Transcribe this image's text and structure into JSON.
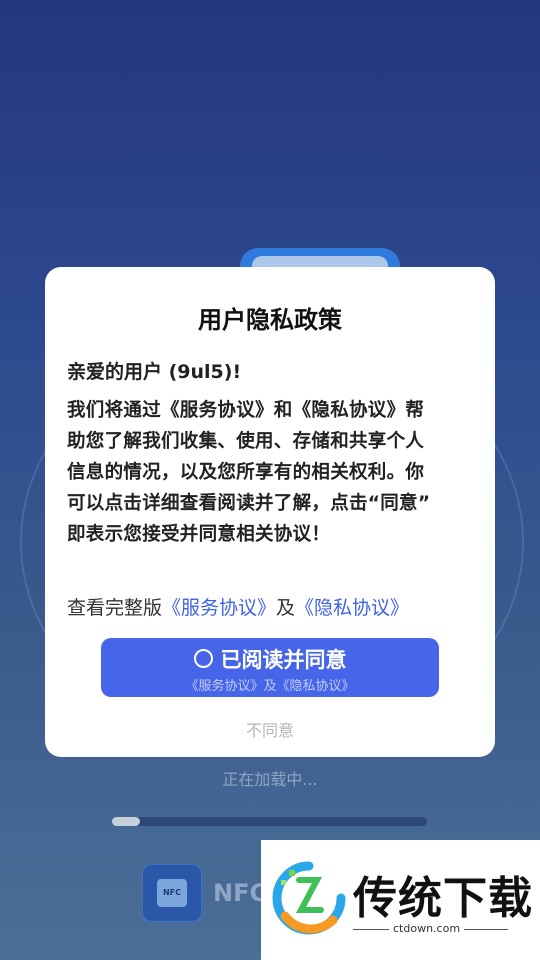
{
  "dialog": {
    "title": "用户隐私政策",
    "greeting": "亲爱的用户 (9ul5)!",
    "body_lines": [
      "我们将通过《服务协议》和《隐私协议》帮",
      "助您了解我们收集、使用、存储和共享个人",
      "信息的情况，以及您所享有的相关权利。你",
      "可以点击详细查看阅读并了解，点击“同意”",
      "即表示您接受并同意相关协议！"
    ],
    "links_prefix": "查看完整版",
    "link_service": "《服务协议》",
    "links_and": "及",
    "link_privacy": "《隐私协议》",
    "agree_label": "已阅读并同意",
    "agree_sub": "《服务协议》及《隐私协议》",
    "disagree_label": "不同意"
  },
  "loading": {
    "text": "正在加载中...",
    "progress": 0.09
  },
  "app": {
    "icon_label": "NFC",
    "name": "NFC"
  },
  "watermark": {
    "text": "传统下载",
    "url": "ctdown.com"
  },
  "colors": {
    "accent": "#4665e8",
    "link": "#3f63e6"
  }
}
